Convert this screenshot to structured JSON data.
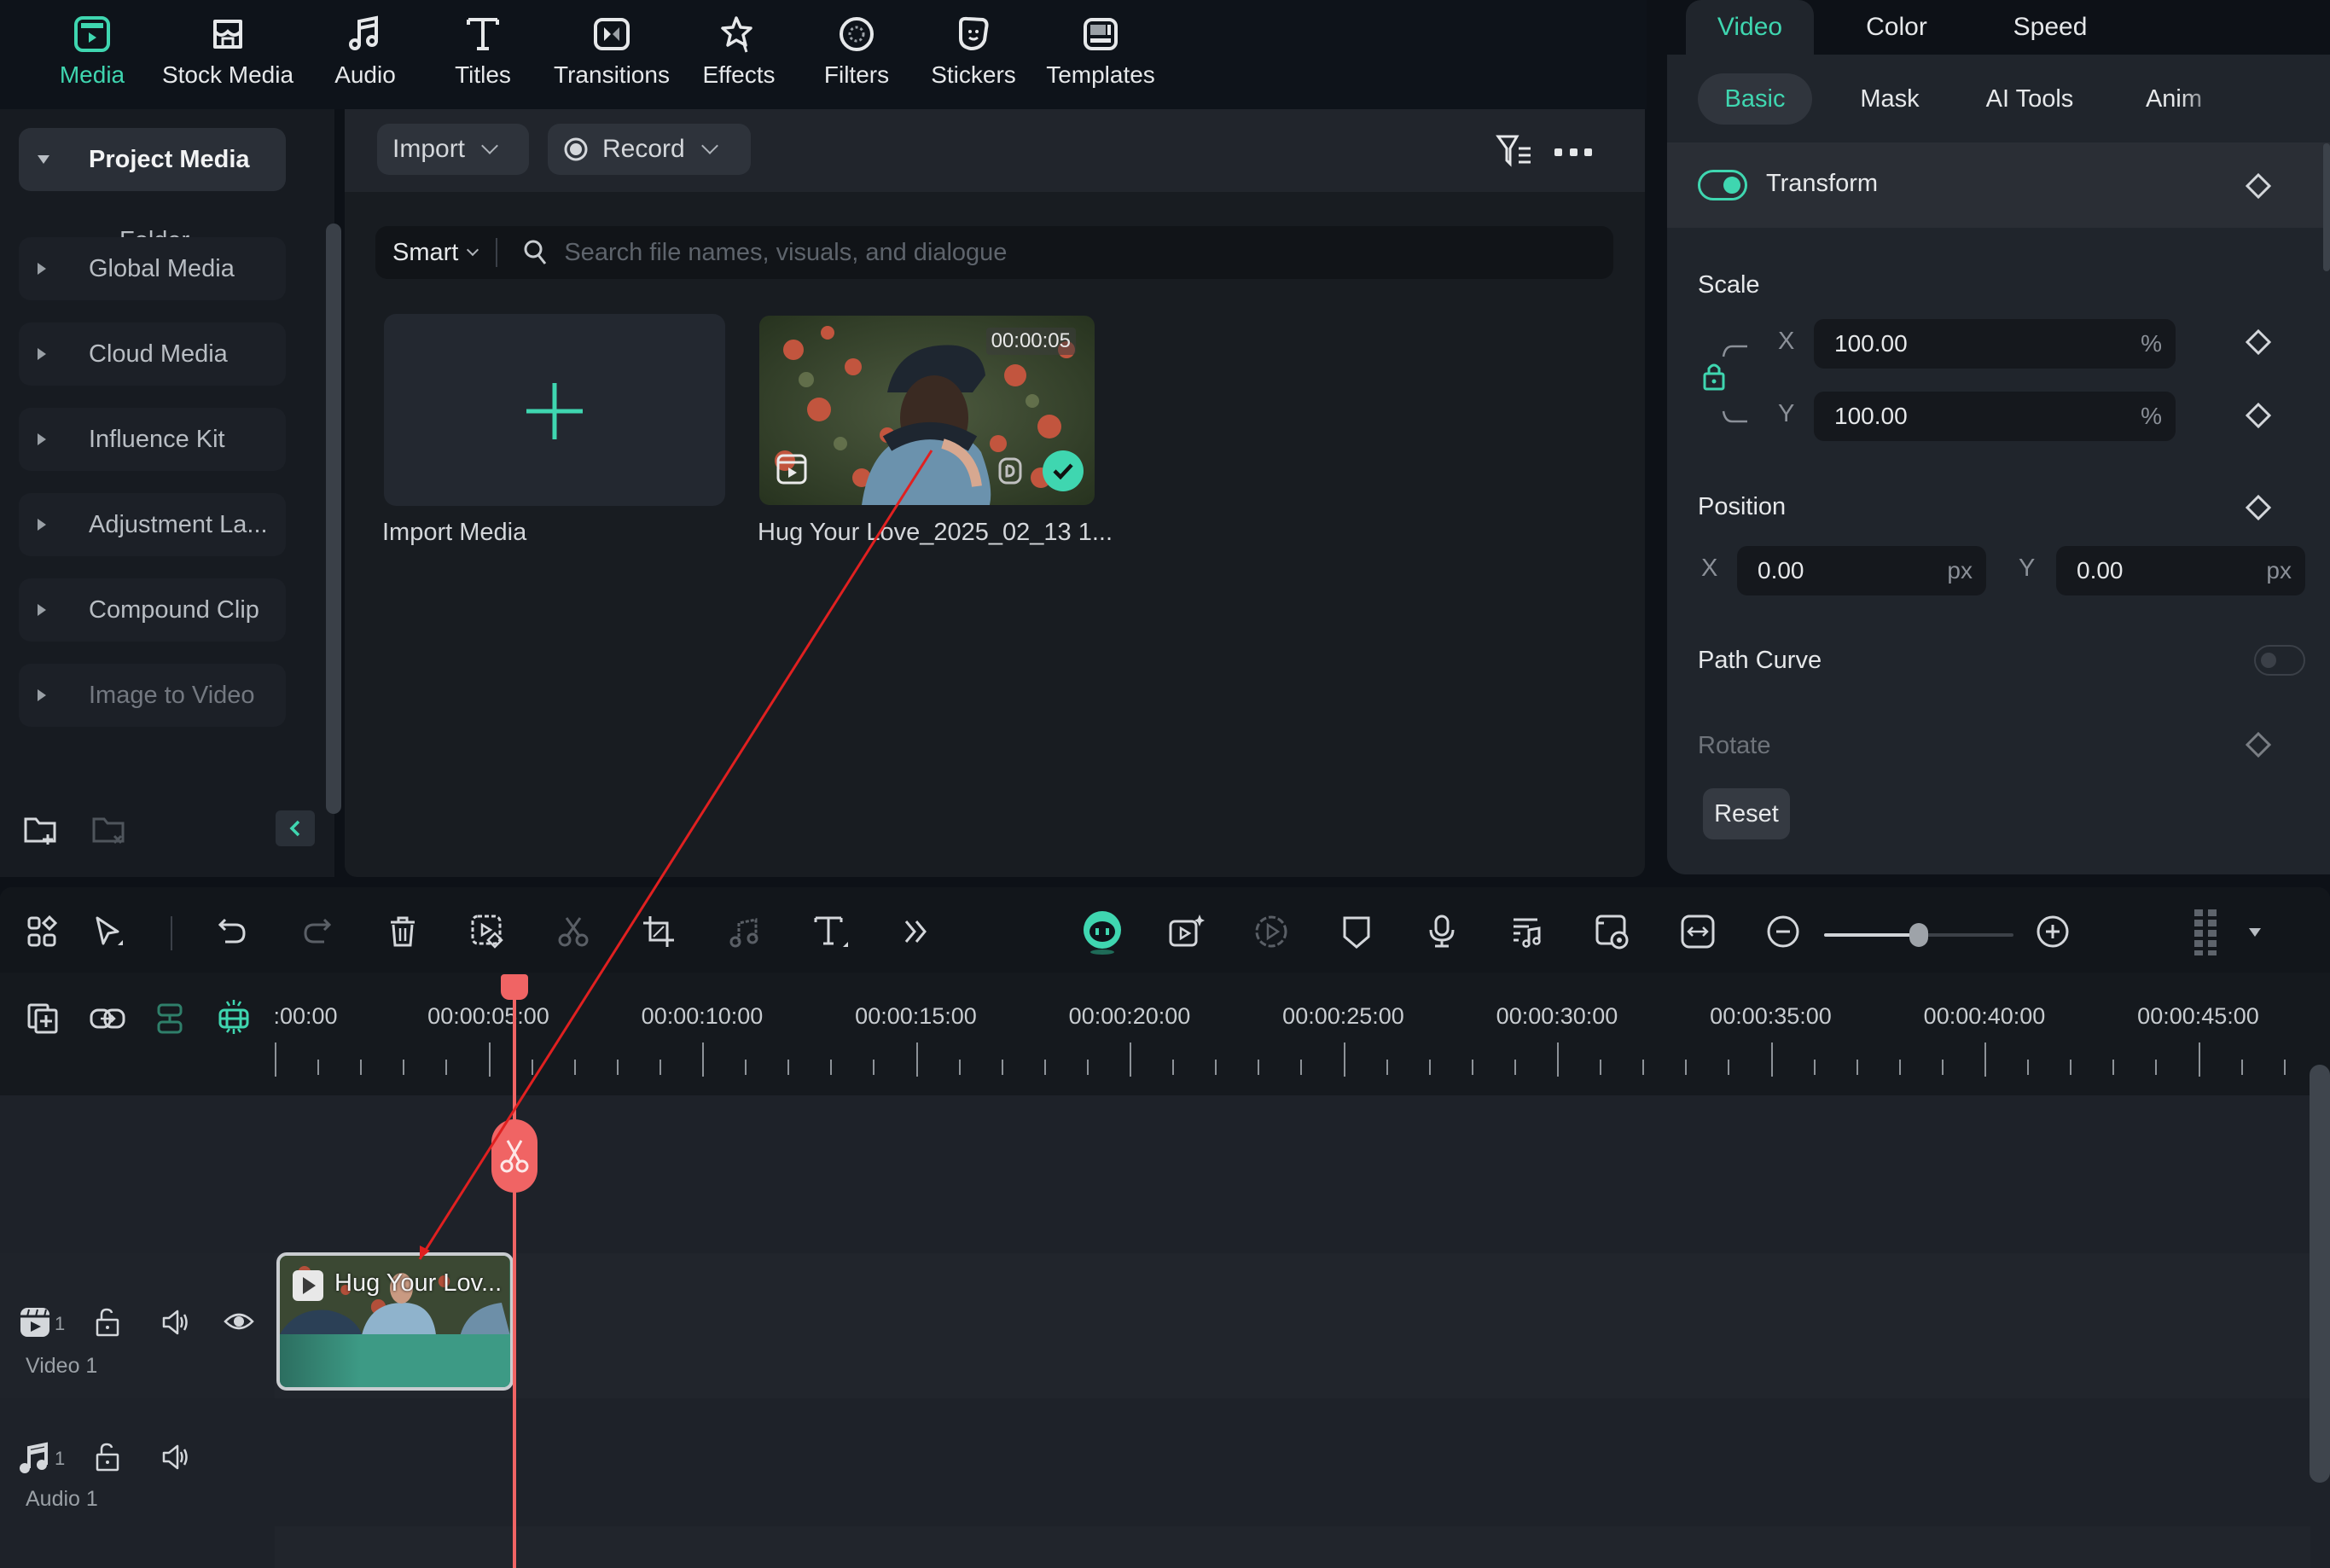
{
  "topnav": {
    "items": [
      {
        "label": "Media",
        "icon": "media-icon",
        "active": true
      },
      {
        "label": "Stock Media",
        "icon": "stock-media-icon",
        "active": false
      },
      {
        "label": "Audio",
        "icon": "music-note-icon",
        "active": false
      },
      {
        "label": "Titles",
        "icon": "text-t-icon",
        "active": false
      },
      {
        "label": "Transitions",
        "icon": "transitions-icon",
        "active": false
      },
      {
        "label": "Effects",
        "icon": "effects-star-icon",
        "active": false
      },
      {
        "label": "Filters",
        "icon": "filters-icon",
        "active": false
      },
      {
        "label": "Stickers",
        "icon": "sticker-icon",
        "active": false
      },
      {
        "label": "Templates",
        "icon": "templates-icon",
        "active": false
      }
    ]
  },
  "sidebar": {
    "items": [
      {
        "label": "Project Media",
        "expanded": true
      },
      {
        "label": "Global Media"
      },
      {
        "label": "Cloud Media"
      },
      {
        "label": "Influence Kit"
      },
      {
        "label": "Adjustment La..."
      },
      {
        "label": "Compound Clip"
      },
      {
        "label": "Image to Video"
      }
    ],
    "folder_label": "Folder",
    "new_folder_icon": "folder-add-icon",
    "delete_folder_icon": "folder-delete-icon",
    "collapse_icon": "chevron-left-icon"
  },
  "media": {
    "import_label": "Import",
    "record_label": "Record",
    "smart_label": "Smart",
    "search_placeholder": "Search file names, visuals, and dialogue",
    "search_value": "",
    "import_tile_label": "Import Media",
    "clips": [
      {
        "name": "Hug Your Love_2025_02_13 1...",
        "duration": "00:00:05",
        "added": true
      }
    ]
  },
  "props": {
    "tabs": [
      {
        "label": "Video",
        "active": true
      },
      {
        "label": "Color",
        "active": false
      },
      {
        "label": "Speed",
        "active": false
      }
    ],
    "subtabs": [
      {
        "label": "Basic",
        "active": true
      },
      {
        "label": "Mask",
        "active": false
      },
      {
        "label": "AI Tools",
        "active": false
      },
      {
        "label": "Anim",
        "active": false
      }
    ],
    "transform": {
      "label": "Transform",
      "enabled": true
    },
    "scale": {
      "label": "Scale",
      "x_label": "X",
      "x_value": "100.00",
      "x_unit": "%",
      "y_label": "Y",
      "y_value": "100.00",
      "y_unit": "%",
      "locked": true
    },
    "position": {
      "label": "Position",
      "x_label": "X",
      "x_value": "0.00",
      "x_unit": "px",
      "y_label": "Y",
      "y_value": "0.00",
      "y_unit": "px"
    },
    "path_curve": {
      "label": "Path Curve",
      "enabled": false
    },
    "rotate": {
      "label": "Rotate"
    },
    "reset_label": "Reset"
  },
  "timeline": {
    "toolbar_icons": [
      "layout-grid-icon",
      "select-arrow-icon",
      "undo-icon",
      "redo-icon",
      "delete-icon",
      "crop-detect-icon",
      "scissors-icon",
      "crop-icon",
      "audio-detach-icon",
      "text-icon",
      "more-chevrons-icon",
      "ai-mascot-icon",
      "camera-ai-icon",
      "play-circle-icon",
      "shield-marker-icon",
      "microphone-icon",
      "audio-mix-icon",
      "snapshot-icon",
      "fit-width-icon",
      "zoom-out-icon",
      "zoom-in-icon",
      "grid-view-icon"
    ],
    "zoom_level": 0.5,
    "ruler_labels": [
      ":00:00",
      "00:00:05:00",
      "00:00:10:00",
      "00:00:15:00",
      "00:00:20:00",
      "00:00:25:00",
      "00:00:30:00",
      "00:00:35:00",
      "00:00:40:00",
      "00:00:45:00"
    ],
    "playhead_seconds": 5.6,
    "tracks": [
      {
        "name": "Video 1",
        "number": "1",
        "type": "video"
      },
      {
        "name": "Audio 1",
        "number": "1",
        "type": "audio"
      }
    ],
    "clip": {
      "title": "Hug Your Lov...",
      "start_seconds": 0,
      "end_seconds": 5.5
    }
  },
  "colors": {
    "accent": "#3fd6b0",
    "playhead": "#f06464",
    "clip_bar": "#3d9a85",
    "annotation": "#e02020"
  }
}
